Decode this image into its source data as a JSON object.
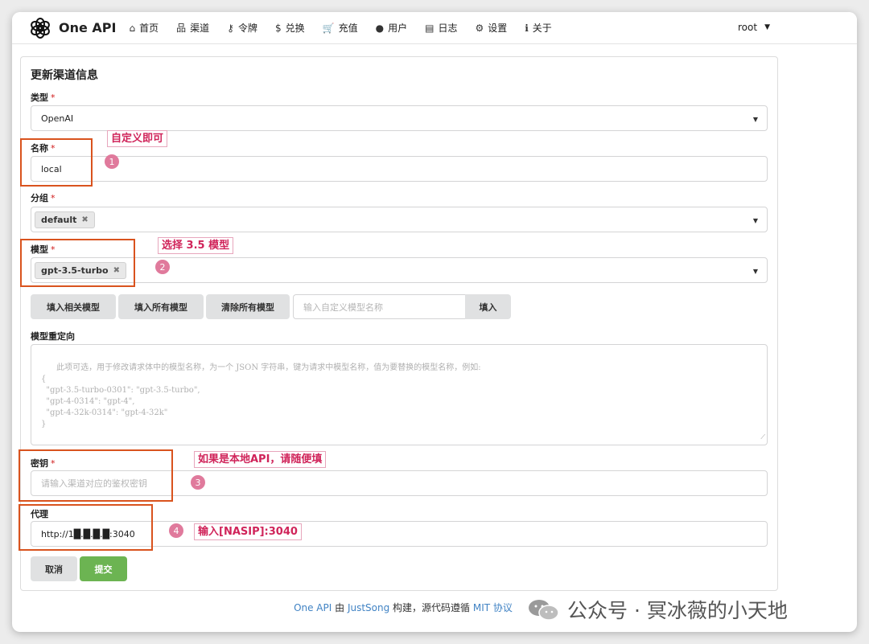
{
  "app": {
    "name": "One API"
  },
  "nav": [
    {
      "icon": "home-icon",
      "glyph": "⌂",
      "label": "首页"
    },
    {
      "icon": "sitemap-icon",
      "glyph": "品",
      "label": "渠道"
    },
    {
      "icon": "key-icon",
      "glyph": "⚷",
      "label": "令牌"
    },
    {
      "icon": "dollar-icon",
      "glyph": "$",
      "label": "兑换"
    },
    {
      "icon": "cart-icon",
      "glyph": "🛒",
      "label": "充值"
    },
    {
      "icon": "user-icon",
      "glyph": "●",
      "label": "用户"
    },
    {
      "icon": "book-icon",
      "glyph": "▤",
      "label": "日志"
    },
    {
      "icon": "gear-icon",
      "glyph": "⚙",
      "label": "设置"
    },
    {
      "icon": "info-icon",
      "glyph": "ℹ",
      "label": "关于"
    }
  ],
  "user": {
    "name": "root"
  },
  "form": {
    "title": "更新渠道信息",
    "type_label": "类型",
    "type_value": "OpenAI",
    "name_label": "名称",
    "name_value": "local",
    "group_label": "分组",
    "group_chip": "default",
    "models_label": "模型",
    "model_chip": "gpt-3.5-turbo",
    "btn_fill_related": "填入相关模型",
    "btn_fill_all": "填入所有模型",
    "btn_clear_all": "清除所有模型",
    "custom_model_placeholder": "输入自定义模型名称",
    "btn_fill": "填入",
    "redirect_label": "模型重定向",
    "redirect_placeholder": "此项可选，用于修改请求体中的模型名称，为一个 JSON 字符串，键为请求中模型名称，值为要替换的模型名称，例如:\n{\n  \"gpt-3.5-turbo-0301\": \"gpt-3.5-turbo\",\n  \"gpt-4-0314\": \"gpt-4\",\n  \"gpt-4-32k-0314\": \"gpt-4-32k\"\n}",
    "key_label": "密钥",
    "key_placeholder": "请输入渠道对应的鉴权密钥",
    "proxy_label": "代理",
    "proxy_value": "http://1█.█.█.█:3040",
    "btn_cancel": "取消",
    "btn_submit": "提交"
  },
  "annotations": {
    "a1": "自定义即可",
    "a2": "选择 3.5 模型",
    "a3": "如果是本地API，请随便填",
    "a4": "输入[NASIP]:3040",
    "n1": "1",
    "n2": "2",
    "n3": "3",
    "n4": "4"
  },
  "footer": {
    "app": "One API",
    "by": " 由 ",
    "author": "JustSong",
    "built": " 构建，源代码遵循 ",
    "license": "MIT 协议"
  },
  "watermark": {
    "text": "公众号 · 冥冰薇的小天地"
  },
  "colors": {
    "accent_red": "#d9531e",
    "annotation_pink": "#d0245a",
    "submit_green": "#6cb452",
    "link_blue": "#4183c4"
  }
}
